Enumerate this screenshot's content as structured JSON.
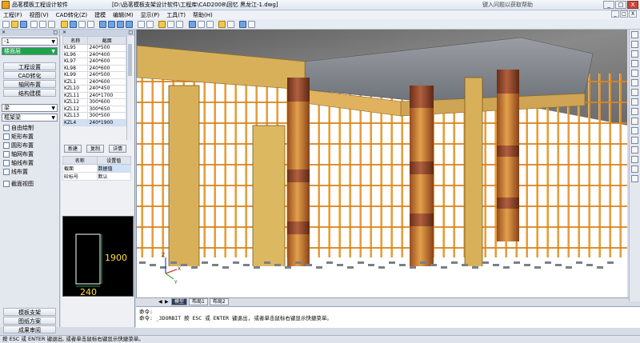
{
  "titlebar": {
    "app_name": "品茗模板工程设计软件",
    "document": "[D:\\品茗模板支架设计软件\\工程库\\CAD2008\\回忆  黑龙江-1.dwg]",
    "help_prompt": "键入问题以获取帮助",
    "minimize": "_",
    "maximize": "□",
    "close": "X"
  },
  "menu": {
    "items": [
      "工程(F)",
      "视图(V)",
      "CAD转化(Z)",
      "建模",
      "编辑(M)",
      "显示(P)",
      "工具(T)",
      "帮助(H)"
    ],
    "mdi_buttons": [
      "_",
      "□",
      "X"
    ]
  },
  "left_panel": {
    "head_left": "×",
    "head_right": "□",
    "floor_select": "-1",
    "floor_green": "楼面层",
    "nav_buttons": [
      "工程设置",
      "CAD转化",
      "轴网布置",
      "结构建模"
    ],
    "type_select": "梁",
    "subtype_select": "框架梁",
    "tree_items": [
      "自由绘制",
      "矩形布置",
      "圆形布置",
      "轴网布置",
      "轴线布置",
      "线布置"
    ],
    "view_item": "截面视图",
    "bottom_buttons": [
      "模板支架",
      "图纸方案",
      "成果审阅"
    ]
  },
  "component_list": {
    "headers": [
      "名称",
      "截面"
    ],
    "rows": [
      [
        "KL95",
        "240*500"
      ],
      [
        "KL96",
        "240*400"
      ],
      [
        "KL97",
        "240*600"
      ],
      [
        "KL98",
        "240*600"
      ],
      [
        "KL99",
        "240*500"
      ],
      [
        "KZL1",
        "240*600"
      ],
      [
        "KZL10",
        "240*450"
      ],
      [
        "KZL11",
        "240*1700"
      ],
      [
        "KZL12",
        "300*600"
      ],
      [
        "KZL12",
        "300*650"
      ],
      [
        "KZL13",
        "300*500"
      ],
      [
        "KZL4",
        "240*1900"
      ]
    ],
    "selected_index": 11,
    "buttons": [
      "新建",
      "复制",
      "详情"
    ],
    "props_headers": [
      "名称",
      "设置值"
    ],
    "props": [
      [
        "截面",
        "数据值"
      ],
      [
        "砼标号",
        "默认"
      ]
    ]
  },
  "section_preview": {
    "height_label": "1900",
    "width_label": "240"
  },
  "viewport": {
    "axis_x": "X",
    "axis_y": "Y",
    "axis_z": "Z"
  },
  "tabs": {
    "nav": [
      "◀",
      "▶"
    ],
    "items": [
      "模型",
      "布局1",
      "布局2"
    ],
    "active_index": 0
  },
  "command": {
    "line1": "命令:",
    "line2": "命令: _3DORBIT 按 ESC 或 ENTER 键退出, 或者单击鼠标右键显示快捷菜单。",
    "line3": ""
  },
  "status": {
    "text": "按 ESC 或 ENTER 键退出, 或者单击鼠标右键显示快捷菜单。"
  },
  "colors": {
    "formwork_orange": "#e0922a",
    "slab_gray": "#8b8f95",
    "column_brown": "#8a4a28",
    "plywood_yellow": "#d8b05a",
    "rock_bg": "#6f6f6f",
    "floor_white": "#ffffff"
  }
}
